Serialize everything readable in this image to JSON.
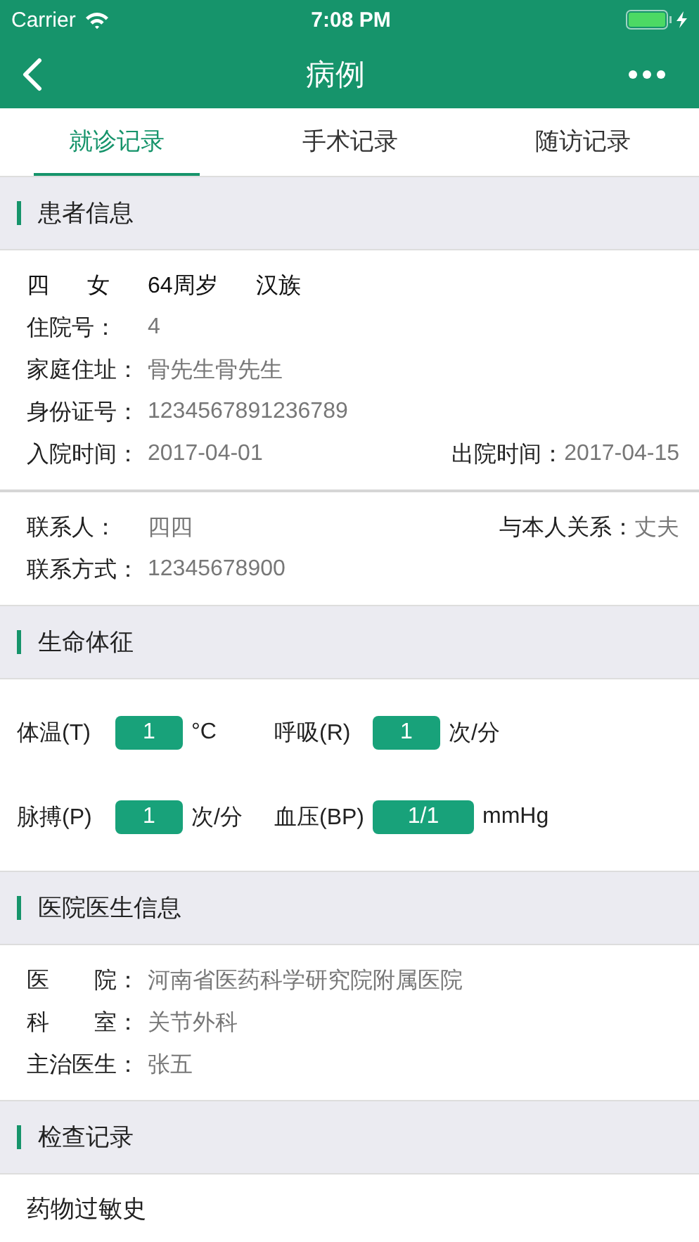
{
  "status_bar": {
    "carrier": "Carrier",
    "time": "7:08 PM"
  },
  "nav": {
    "title": "病例"
  },
  "tabs": [
    {
      "label": "就诊记录",
      "selected": true
    },
    {
      "label": "手术记录",
      "selected": false
    },
    {
      "label": "随访记录",
      "selected": false
    }
  ],
  "sections": [
    {
      "title": "患者信息",
      "kind": "info",
      "groups": [
        {
          "rows": [
            {
              "kind": "summary",
              "items": [
                "四",
                "女",
                "64周岁",
                "汉族"
              ]
            },
            {
              "kind": "field",
              "label": "住院号：",
              "value": "4"
            },
            {
              "kind": "field",
              "label": "家庭住址：",
              "value": "骨先生骨先生"
            },
            {
              "kind": "field",
              "label": "身份证号：",
              "value": "1234567891236789"
            },
            {
              "kind": "field",
              "label": "入院时间：",
              "value": "2017-04-01",
              "right_label": "出院时间：",
              "right_value": "2017-04-15"
            }
          ]
        },
        {
          "rows": [
            {
              "kind": "field",
              "label": "联系人：",
              "value": "四四",
              "right_label": "与本人关系：",
              "right_value": "丈夫"
            },
            {
              "kind": "field",
              "label": "联系方式：",
              "value": "12345678900"
            }
          ]
        }
      ]
    },
    {
      "title": "生命体征",
      "kind": "vitals",
      "rows": [
        [
          {
            "label": "体温(T)",
            "value": "1",
            "unit": "°C"
          },
          {
            "label": "呼吸(R)",
            "value": "1",
            "unit": "次/分"
          }
        ],
        [
          {
            "label": "脉搏(P)",
            "value": "1",
            "unit": "次/分"
          },
          {
            "label": "血压(BP)",
            "value": "1/1",
            "unit": "mmHg"
          }
        ]
      ]
    },
    {
      "title": "医院医生信息",
      "kind": "info",
      "groups": [
        {
          "rows": [
            {
              "kind": "field",
              "label": "医　　院：",
              "value": "河南省医药科学研究院附属医院"
            },
            {
              "kind": "field",
              "label": "科　　室：",
              "value": "关节外科"
            },
            {
              "kind": "field",
              "label": "主治医生：",
              "value": "张五"
            }
          ]
        }
      ]
    },
    {
      "title": "检查记录",
      "kind": "list",
      "items": [
        "药物过敏史"
      ]
    }
  ]
}
